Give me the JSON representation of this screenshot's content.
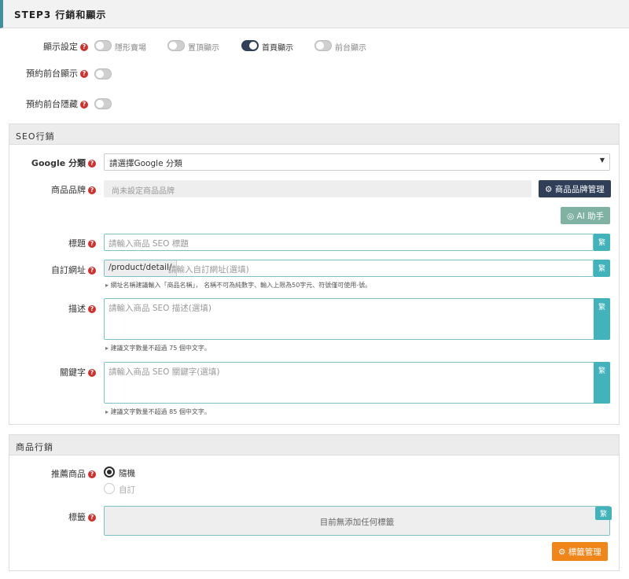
{
  "step": {
    "title": "STEP3 行銷和顯示"
  },
  "display": {
    "label": "顯示設定",
    "options": [
      {
        "label": "隱形賣場",
        "on": false
      },
      {
        "label": "置頂顯示",
        "on": false
      },
      {
        "label": "首頁顯示",
        "on": true
      },
      {
        "label": "前台顯示",
        "on": false
      }
    ],
    "schedule_show_label": "預約前台顯示",
    "schedule_hide_label": "預約前台隱藏"
  },
  "help_mark": "?",
  "seo": {
    "panel_title": "SEO行銷",
    "google_label": "Google 分類",
    "google_value": "請選擇Google 分類",
    "brand_label": "商品品牌",
    "brand_placeholder": "尚未設定商品品牌",
    "brand_button": "商品品牌管理",
    "ai_button": "AI 助手",
    "title_label": "標題",
    "title_placeholder": "請輸入商品 SEO 標題",
    "url_label": "自訂網址",
    "url_prefix": "/product/detail/",
    "url_placeholder": "請輸入自訂網址(選填)",
    "url_hint": "網址名稱建議輸入「商品名稱」， 名稱不可為純數字、輸入上限為50字元、符號僅可使用-號。",
    "desc_label": "描述",
    "desc_placeholder": "請輸入商品 SEO 描述(選填)",
    "desc_hint": "建議文字數量不超過 75 個中文字。",
    "keyword_label": "關鍵字",
    "keyword_placeholder": "請輸入商品 SEO 關鍵字(選填)",
    "keyword_hint": "建議文字數量不超過 85 個中文字。",
    "trad_label": "繁"
  },
  "marketing": {
    "panel_title": "商品行銷",
    "recommend_label": "推薦商品",
    "radio_random": "隨機",
    "radio_custom": "自訂",
    "tags_label": "標籤",
    "tags_empty": "目前無添加任何標籤",
    "tags_button": "標籤管理"
  }
}
